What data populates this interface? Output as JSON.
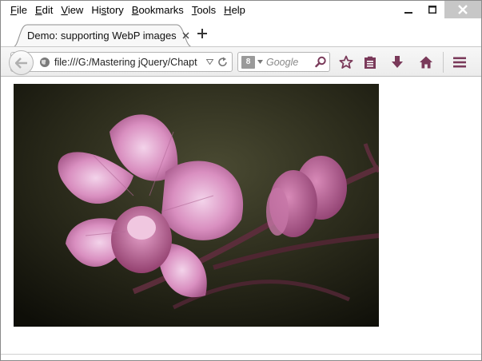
{
  "menu": {
    "items": [
      "File",
      "Edit",
      "View",
      "History",
      "Bookmarks",
      "Tools",
      "Help"
    ],
    "mnemonics": [
      "F",
      "E",
      "V",
      "s",
      "B",
      "T",
      "H"
    ]
  },
  "window_controls": {
    "minimize_icon": "minimize-icon",
    "maximize_icon": "maximize-icon",
    "close_icon": "close-icon"
  },
  "tab": {
    "title": "Demo: supporting WebP images",
    "close_icon": "close-icon"
  },
  "new_tab_icon": "plus-icon",
  "navigation": {
    "url": "file:///G:/Mastering jQuery/Chapt",
    "search_engine_badge": "8",
    "search_placeholder": "Google"
  },
  "toolbar_icons": [
    "star-icon",
    "reading-list-icon",
    "download-icon",
    "home-icon",
    "menu-icon"
  ],
  "content": {
    "image_subject": "pink orchid flowers on a dark background"
  },
  "colors": {
    "toolbar_icon": "#7a3a5a",
    "close_button_bg": "#c7c7c7",
    "tab_border": "#8e8e8e"
  }
}
